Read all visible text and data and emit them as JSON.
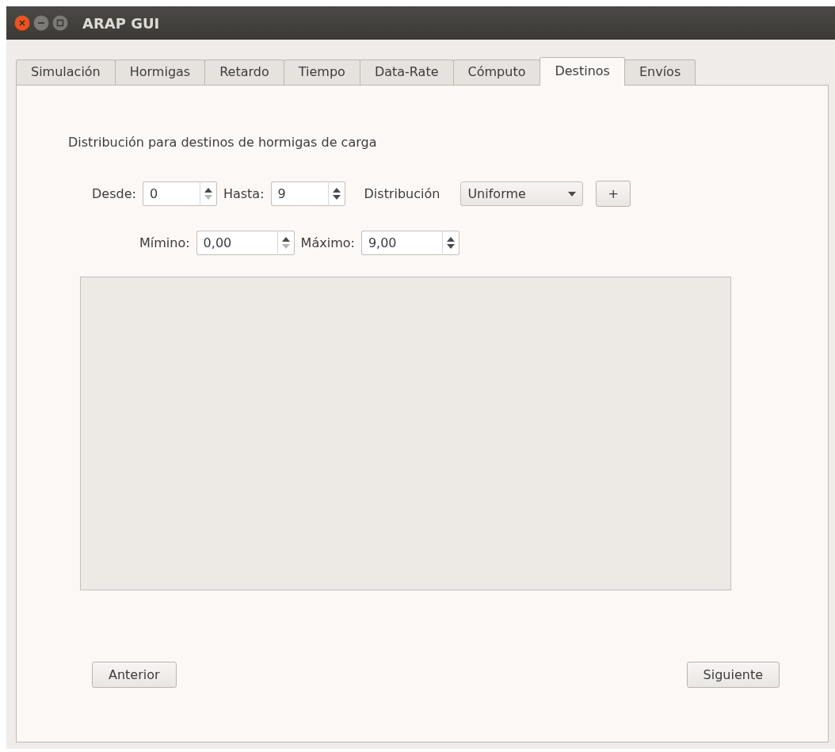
{
  "window": {
    "title": "ARAP GUI"
  },
  "tabs": [
    {
      "label": "Simulación",
      "selected": false
    },
    {
      "label": "Hormigas",
      "selected": false
    },
    {
      "label": "Retardo",
      "selected": false
    },
    {
      "label": "Tiempo",
      "selected": false
    },
    {
      "label": "Data-Rate",
      "selected": false
    },
    {
      "label": "Cómputo",
      "selected": false
    },
    {
      "label": "Destinos",
      "selected": true
    },
    {
      "label": "Envíos",
      "selected": false
    }
  ],
  "heading": "Distribución para destinos de hormigas de carga",
  "range": [
    {
      "label": "Desde:",
      "value": "0",
      "down_disabled": true
    },
    {
      "label": "Hasta:",
      "value": "9",
      "down_disabled": false
    }
  ],
  "distribution": {
    "label": "Distribución",
    "value": "Uniforme",
    "add_button": "+"
  },
  "limits": [
    {
      "label": "Mímino:",
      "value": "0,00",
      "down_disabled": true
    },
    {
      "label": "Máximo:",
      "value": "9,00",
      "down_disabled": false
    }
  ],
  "buttons": {
    "previous": "Anterior",
    "next": "Siguiente"
  }
}
